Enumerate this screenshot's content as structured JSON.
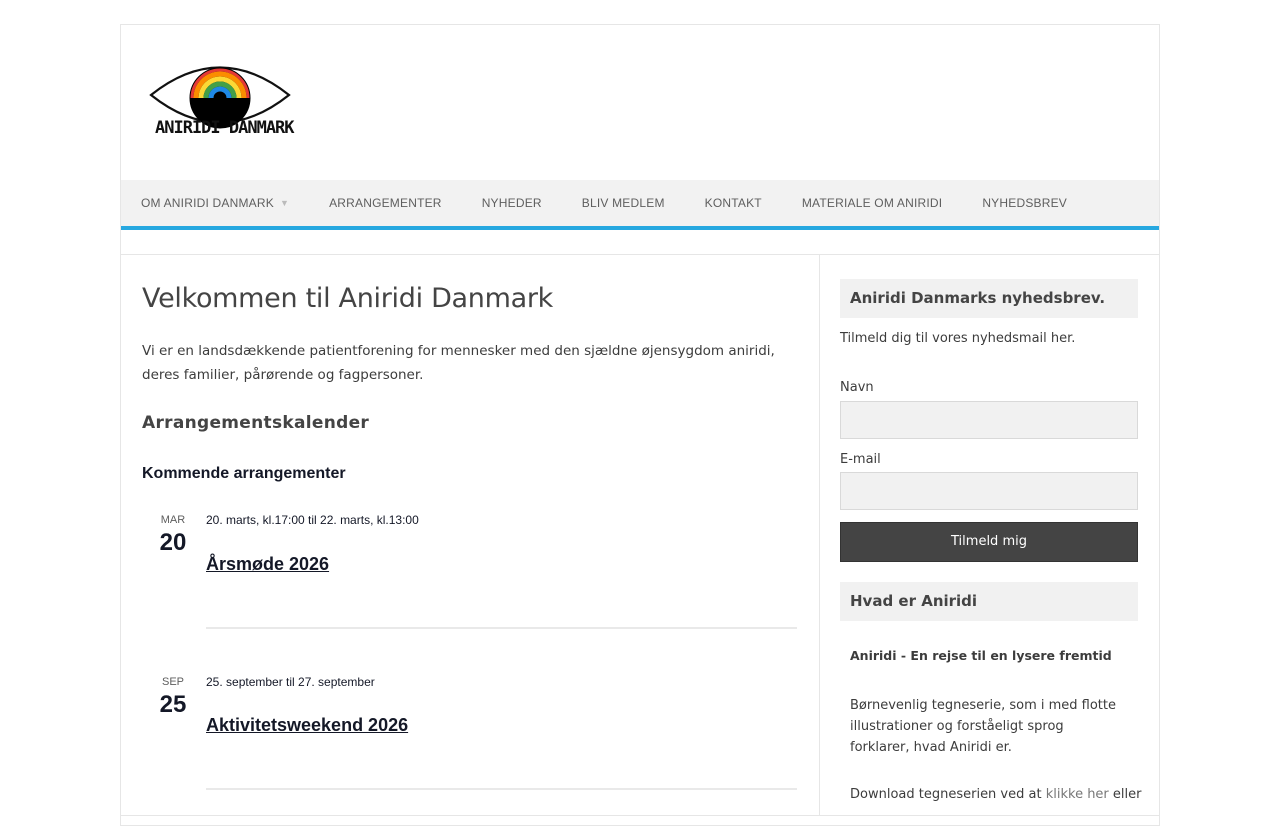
{
  "site": {
    "logo_text": "ANIRIDI DANMARK",
    "accent_color": "#27a8e0"
  },
  "nav": {
    "items": [
      {
        "label": "OM ANIRIDI DANMARK",
        "has_dropdown": true
      },
      {
        "label": "ARRANGEMENTER"
      },
      {
        "label": "NYHEDER"
      },
      {
        "label": "BLIV MEDLEM"
      },
      {
        "label": "KONTAKT"
      },
      {
        "label": "MATERIALE OM ANIRIDI"
      },
      {
        "label": "NYHEDSBREV"
      }
    ]
  },
  "main": {
    "title": "Velkommen til Aniridi Danmark",
    "intro": "Vi er en landsdækkende patientforening for mennesker med den sjældne øjensygdom aniridi, deres familier, pårørende og fagpersoner.",
    "calendar_heading": "Arrangementskalender",
    "upcoming_label": "Kommende arrangementer",
    "events": [
      {
        "month": "MAR",
        "day": "20",
        "date": "20. marts, kl.17:00 til 22. marts, kl.13:00",
        "title": "Årsmøde 2026"
      },
      {
        "month": "SEP",
        "day": "25",
        "date": "25. september til 27. september",
        "title": "Aktivitetsweekend 2026"
      }
    ]
  },
  "sidebar": {
    "newsletter": {
      "title": "Aniridi Danmarks nyhedsbrev.",
      "text": "Tilmeld dig til vores nyhedsmail her.",
      "name_label": "Navn",
      "email_label": "E-mail",
      "submit_label": "Tilmeld mig"
    },
    "about": {
      "title": "Hvad er Aniridi",
      "subtitle": "Aniridi - En rejse til en lysere fremtid",
      "text": "Børnevenlig tegneserie, som i med flotte illustrationer og forståeligt sprog forklarer, hvad Aniridi er.",
      "download_prefix": "Download tegneserien ved at",
      "download_link": "klikke her",
      "download_suffix": "eller"
    }
  }
}
